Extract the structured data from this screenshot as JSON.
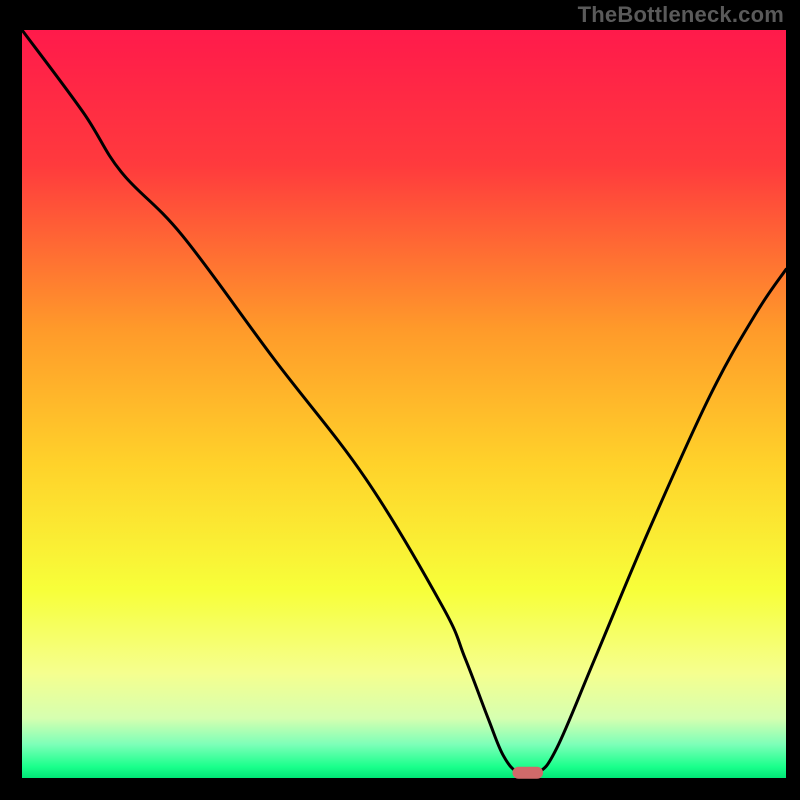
{
  "attribution": "TheBottleneck.com",
  "chart_data": {
    "type": "line",
    "title": "",
    "xlabel": "",
    "ylabel": "",
    "xlim": [
      0,
      100
    ],
    "ylim": [
      0,
      100
    ],
    "grid": false,
    "legend": false,
    "background_gradient": {
      "stops": [
        {
          "offset": 0.0,
          "color": "#ff1a4b"
        },
        {
          "offset": 0.18,
          "color": "#ff3a3d"
        },
        {
          "offset": 0.4,
          "color": "#ff9a2a"
        },
        {
          "offset": 0.58,
          "color": "#ffd22a"
        },
        {
          "offset": 0.75,
          "color": "#f7ff3a"
        },
        {
          "offset": 0.86,
          "color": "#f5ff8f"
        },
        {
          "offset": 0.92,
          "color": "#d6ffb0"
        },
        {
          "offset": 0.955,
          "color": "#7dffb8"
        },
        {
          "offset": 0.985,
          "color": "#1aff8c"
        },
        {
          "offset": 1.0,
          "color": "#00e676"
        }
      ]
    },
    "series": [
      {
        "name": "bottleneck-curve",
        "color": "#000000",
        "x": [
          0,
          8,
          13,
          21,
          33,
          45,
          55,
          58,
          61,
          63,
          65,
          67.5,
          70,
          75,
          82,
          90,
          96,
          100
        ],
        "values": [
          100,
          89,
          81,
          72.5,
          56,
          40,
          23,
          16,
          8,
          3,
          0.7,
          0.7,
          4,
          16,
          33,
          51,
          62,
          68
        ]
      }
    ],
    "marker": {
      "name": "optimal-zone-marker",
      "x": 66.2,
      "y": 0.7,
      "width": 4.0,
      "height": 1.6,
      "color": "#d06a6a"
    }
  }
}
